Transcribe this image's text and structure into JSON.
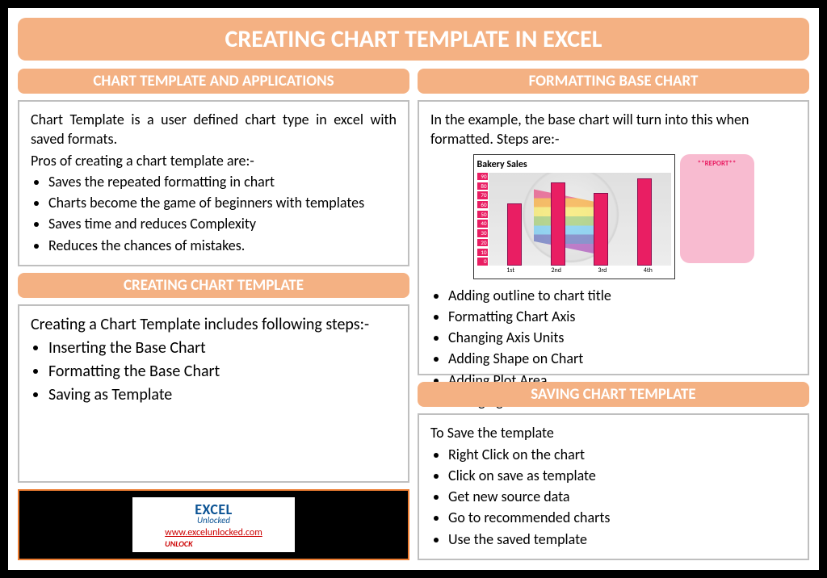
{
  "title": "CREATING CHART TEMPLATE IN EXCEL",
  "left": {
    "s1_header": "CHART TEMPLATE AND APPLICATIONS",
    "s1_intro1": "Chart Template is a user defined chart type in excel with saved formats.",
    "s1_intro2": "Pros of creating a chart template are:-",
    "s1_items": [
      "Saves the repeated formatting in chart",
      "Charts become the game of beginners with templates",
      "Saves time and reduces Complexity",
      "Reduces the chances of mistakes."
    ],
    "s2_header": "CREATING CHART TEMPLATE",
    "s2_intro": "Creating a Chart Template includes following steps:-",
    "s2_items": [
      "Inserting the Base Chart",
      "Formatting the Base Chart",
      "Saving as Template"
    ],
    "logo_top": "EXCEL",
    "logo_sub": "Unlocked",
    "logo_url": "www.excelunlocked.com",
    "logo_unlock": "UNLOCK"
  },
  "right": {
    "s3_header": "FORMATTING BASE CHART",
    "s3_intro": "In the example, the base chart will turn into this when formatted. Steps are:-",
    "s3_items": [
      "Adding outline to chart title",
      "Formatting Chart Axis",
      "Changing Axis Units",
      "Adding Shape on Chart",
      "Adding Plot Area",
      "Changing Bar Colors"
    ],
    "s4_header": "SAVING CHART TEMPLATE",
    "s4_intro": "To Save the template",
    "s4_items": [
      "Right Click on the chart",
      "Click on save as template",
      "Get new source data",
      "Go to recommended charts",
      "Use the saved template"
    ],
    "report_label": "**REPORT**"
  },
  "chart_data": {
    "type": "bar",
    "title": "Bakery Sales",
    "categories": [
      "1st",
      "2nd",
      "3rd",
      "4th"
    ],
    "values": [
      60,
      80,
      70,
      85
    ],
    "ylim": [
      0,
      90
    ],
    "y_ticks": [
      90,
      80,
      70,
      60,
      50,
      40,
      30,
      20,
      10,
      0
    ],
    "xlabel": "",
    "ylabel": ""
  }
}
